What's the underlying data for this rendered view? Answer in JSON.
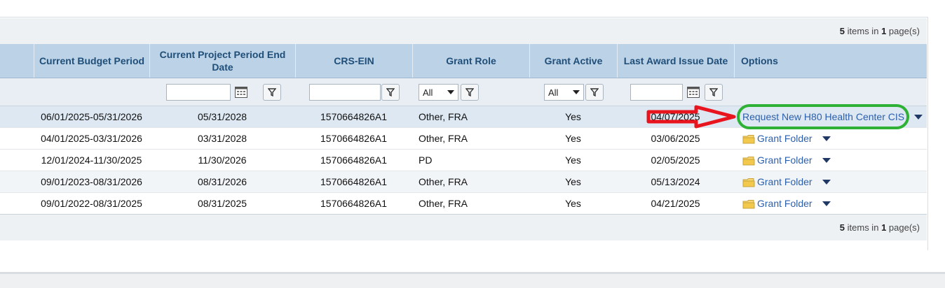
{
  "pager": {
    "count": "5",
    "text_mid": "items in",
    "page": "1",
    "text_end": "page(s)"
  },
  "columns": {
    "budget_period": "Current Budget Period",
    "project_end": "Current Project Period End Date",
    "crs_ein": "CRS-EIN",
    "grant_role": "Grant Role",
    "grant_active": "Grant Active",
    "last_award": "Last Award Issue Date",
    "options": "Options"
  },
  "filters": {
    "grant_role_value": "All",
    "grant_active_value": "All"
  },
  "rows": [
    {
      "budget_period": "06/01/2025-05/31/2026",
      "project_end": "05/31/2028",
      "crs_ein": "1570664826A1",
      "grant_role": "Other, FRA",
      "grant_active": "Yes",
      "last_award": "04/07/2025",
      "option": "Request New H80 Health Center CIS"
    },
    {
      "budget_period": "04/01/2025-03/31/2026",
      "project_end": "03/31/2028",
      "crs_ein": "1570664826A1",
      "grant_role": "Other, FRA",
      "grant_active": "Yes",
      "last_award": "03/06/2025",
      "option": "Grant Folder"
    },
    {
      "budget_period": "12/01/2024-11/30/2025",
      "project_end": "11/30/2026",
      "crs_ein": "1570664826A1",
      "grant_role": "PD",
      "grant_active": "Yes",
      "last_award": "02/05/2025",
      "option": "Grant Folder"
    },
    {
      "budget_period": "09/01/2023-08/31/2026",
      "project_end": "08/31/2026",
      "crs_ein": "1570664826A1",
      "grant_role": "Other, FRA",
      "grant_active": "Yes",
      "last_award": "05/13/2024",
      "option": "Grant Folder"
    },
    {
      "budget_period": "09/01/2022-08/31/2025",
      "project_end": "08/31/2025",
      "crs_ein": "1570664826A1",
      "grant_role": "Other, FRA",
      "grant_active": "Yes",
      "last_award": "04/21/2025",
      "option": "Grant Folder"
    }
  ],
  "colors": {
    "annotation_arrow": "#e8141e",
    "annotation_oval": "#2fb135",
    "link": "#2c5faa",
    "header_bg": "#bcd2e6"
  },
  "icons": {
    "filter": "funnel-icon",
    "calendar": "calendar-icon",
    "folder": "folder-icon",
    "dropdown": "chevron-down-icon"
  }
}
